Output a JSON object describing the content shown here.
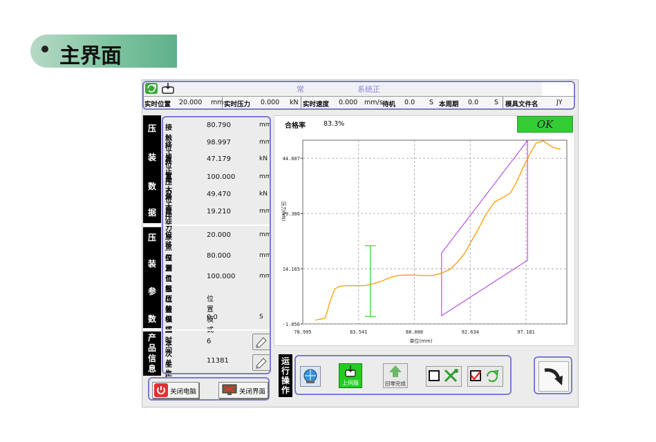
{
  "slide": {
    "title": "主界面"
  },
  "topbar": {
    "status_left": "常",
    "status_right": "系统正",
    "fields": [
      {
        "label": "实时位置",
        "value": "20.000",
        "unit": "mm"
      },
      {
        "label": "实时压力",
        "value": "0.000",
        "unit": "kN"
      },
      {
        "label": "实时速度",
        "value": "0.000",
        "unit": "mm/s"
      },
      {
        "label": "待机",
        "value": "0.0",
        "unit": "S"
      },
      {
        "label": "本周期",
        "value": "0.0",
        "unit": "S"
      },
      {
        "label": "模具文件名",
        "value": "JY",
        "unit": ""
      }
    ]
  },
  "press_data": {
    "section_label": [
      "压",
      "装",
      "数",
      "据"
    ],
    "rows": [
      {
        "key": "接触位置",
        "value": "80.790",
        "unit": "mm"
      },
      {
        "key": "终止位置",
        "value": "98.997",
        "unit": "mm"
      },
      {
        "key": "终止压力",
        "value": "47.179",
        "unit": "kN"
      },
      {
        "key": "最大位置",
        "value": "100.000",
        "unit": "mm"
      },
      {
        "key": "最大压力",
        "value": "49.470",
        "unit": "kN"
      },
      {
        "key": "压装位移",
        "value": "19.210",
        "unit": "mm"
      }
    ]
  },
  "press_params": {
    "section_label": [
      "压",
      "装",
      "参",
      "数"
    ],
    "rows": [
      {
        "key": "原点位置",
        "value": "20.000",
        "unit": "mm"
      },
      {
        "key": "探测位置",
        "value": "80.000",
        "unit": "mm"
      },
      {
        "key": "目标位置",
        "value": "100.000",
        "unit": "mm"
      },
      {
        "key": "压装模式",
        "value": "位置模式",
        "unit": ""
      },
      {
        "key": "保压时间",
        "value": "0.0",
        "unit": "S"
      }
    ]
  },
  "product_info": {
    "section_label": [
      "产",
      "品",
      "信",
      "息"
    ],
    "rows": [
      {
        "key": "本次生产",
        "value": "6"
      },
      {
        "key": "总生产数",
        "value": "11381"
      }
    ]
  },
  "system_buttons": {
    "shutdown": "关闭电脑",
    "close_ui": "关闭界面"
  },
  "chart_header": {
    "pass_label": "合格率",
    "pass_value": "83.3%",
    "ok_text": "OK"
  },
  "operation": {
    "section_label": [
      "运",
      "行",
      "操",
      "作"
    ],
    "buttons": {
      "servo_on": "上伺服",
      "return_home": "回零完成"
    }
  },
  "colors": {
    "curve": "#ff9900",
    "window": "#aa33dd",
    "limit": "#33cc33",
    "ok_bg": "#33cc33",
    "highlight": "#7b7bd0"
  },
  "chart_data": {
    "type": "line",
    "title": "",
    "xlabel": "单位(mm)",
    "ylabel": "压力(kN)",
    "xlim": [
      78.995,
      100.5
    ],
    "ylim": [
      -1.056,
      49.6
    ],
    "x_ticks": [
      "78.995",
      "83.541",
      "88.088",
      "92.634",
      "97.181"
    ],
    "y_ticks": [
      "-1.056",
      "14.165",
      "29.386",
      "44.607"
    ],
    "grid": true,
    "series": [
      {
        "x": [
          80.0,
          80.5,
          80.8,
          81.0,
          81.2,
          81.6,
          82.0,
          82.6,
          83.2,
          84.0,
          84.4,
          84.8,
          85.4,
          86.0,
          86.6,
          87.2,
          88.0,
          88.8,
          89.6,
          90.2,
          91.0,
          91.6,
          92.2,
          92.6,
          93.2,
          93.8,
          94.6,
          95.4,
          95.9,
          96.4,
          97.0,
          97.6,
          98.0,
          98.6,
          99.0,
          99.4,
          99.8,
          100.0
        ],
        "y": [
          0.0,
          0.3,
          0.5,
          2.5,
          5.0,
          8.6,
          9.3,
          9.5,
          9.5,
          9.5,
          9.7,
          10.1,
          10.7,
          11.6,
          12.2,
          12.4,
          12.4,
          12.3,
          12.3,
          12.8,
          14.0,
          16.0,
          18.5,
          21.0,
          24.5,
          28.5,
          32.5,
          34.0,
          35.0,
          38.0,
          42.5,
          46.5,
          48.8,
          49.4,
          48.4,
          47.6,
          47.2,
          47.2
        ]
      }
    ],
    "window": {
      "x": [
        90.3,
        97.3
      ],
      "y": [
        6.0,
        49.5
      ]
    },
    "limit_bar": {
      "x": 84.5,
      "y": [
        1.0,
        20.5
      ]
    }
  }
}
